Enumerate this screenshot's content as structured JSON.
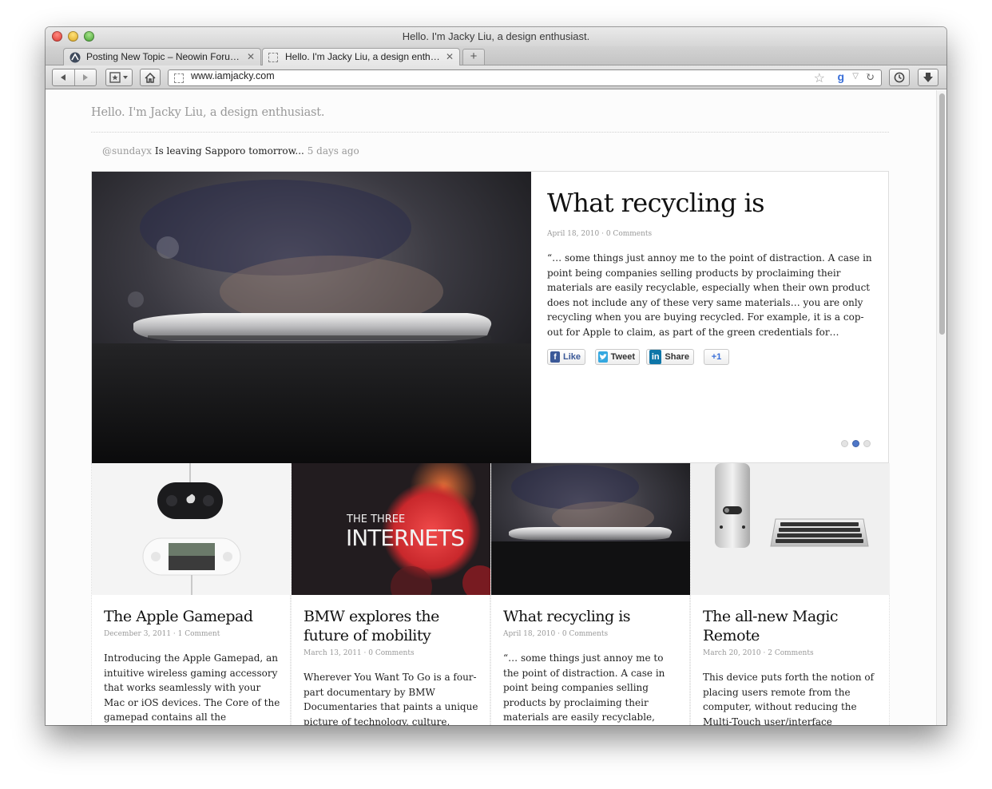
{
  "window": {
    "title": "Hello. I'm Jacky Liu, a design enthusiast."
  },
  "tabs": [
    {
      "label": "Posting New Topic – Neowin Foru…",
      "close": "✕"
    },
    {
      "label": "Hello. I'm Jacky Liu, a design enth…",
      "close": "✕"
    }
  ],
  "toolbar": {
    "new_tab": "+",
    "url": "www.iamjacky.com",
    "star": "☆",
    "search_engine": "g",
    "dropdown": "▽",
    "reload": "↻"
  },
  "site": {
    "title": "Hello. I'm Jacky Liu, a design enthusiast.",
    "tweet": {
      "handle": "@sundayx",
      "text": "Is leaving Sapporo tomorrow...",
      "ago": "5 days ago"
    }
  },
  "featured": {
    "title": "What recycling is",
    "meta": "April 18, 2010 · 0 Comments",
    "excerpt": "“… some things just annoy me to the point of distraction. A case in point being companies selling products by proclaiming their materials are easily recyclable, especially when their own product does not include any of these very same materials… you are only recycling when you are buying recycled. For example, it is a cop-out for Apple to claim, as part of the green credentials for…",
    "share": {
      "like": "Like",
      "tweet": "Tweet",
      "linkedin": "Share",
      "plusone": "+1"
    },
    "slides": {
      "count": 3,
      "active": 2
    }
  },
  "cards": [
    {
      "title": "The Apple Gamepad",
      "meta": "December 3, 2011 · 1 Comment",
      "excerpt": "Introducing the Apple Gamepad, an intuitive wireless gaming accessory that works seamlessly with your Mac or iOS devices. The Core of the gamepad contains all the"
    },
    {
      "title": "BMW explores the future of mobility",
      "meta": "March 13, 2011 · 0 Comments",
      "excerpt": "Wherever You Want To Go is a four-part documentary by BMW Documentaries that paints a unique picture of technology, culture, cities,",
      "thumb_text": {
        "line1": "THE THREE",
        "line2": "INTERNETS"
      }
    },
    {
      "title": "What recycling is",
      "meta": "April 18, 2010 · 0 Comments",
      "excerpt": "“… some things just annoy me to the point of distraction. A case in point being companies selling products by proclaiming their materials are easily recyclable, especially when thei…"
    },
    {
      "title": "The all-new Magic Remote",
      "meta": "March 20, 2010 · 2 Comments",
      "excerpt": "This device puts forth the notion of placing users remote from the computer, without reducing the Multi-Touch user/interface"
    }
  ],
  "colors": {
    "accent": "#4e77c8",
    "meta_text": "#999999",
    "title_text": "#111111"
  }
}
